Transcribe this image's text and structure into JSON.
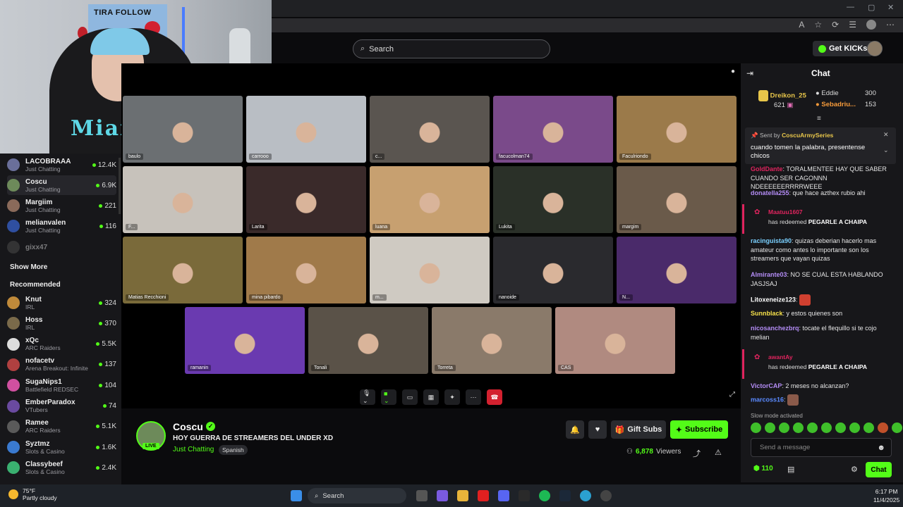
{
  "browser": {
    "window_controls": [
      "—",
      "▢",
      "✕"
    ]
  },
  "header": {
    "search_placeholder": "Search",
    "get_kicks_label": "Get KICKs"
  },
  "webcam": {
    "poster_text": "TIRA FOLLOW",
    "shirt_text": "Miami"
  },
  "sidebar": {
    "following": [
      {
        "name": "LACOBRAAA",
        "category": "Just Chatting",
        "viewers": "12.4K",
        "color": "#6a6f9a"
      },
      {
        "name": "Coscu",
        "category": "Just Chatting",
        "viewers": "6.9K",
        "color": "#6d8a5a",
        "active": true
      },
      {
        "name": "Margiim",
        "category": "Just Chatting",
        "viewers": "221",
        "color": "#8a6a5a"
      },
      {
        "name": "melianvalen",
        "category": "Just Chatting",
        "viewers": "116",
        "color": "#2f4fa0"
      }
    ],
    "offline": {
      "name": "gixx47"
    },
    "show_more_label": "Show More",
    "recommended_label": "Recommended",
    "recommended": [
      {
        "name": "Knut",
        "category": "IRL",
        "viewers": "324",
        "color": "#c08a3a"
      },
      {
        "name": "Hoss",
        "category": "IRL",
        "viewers": "370",
        "color": "#7a6a4a"
      },
      {
        "name": "xQc",
        "category": "ARC Raiders",
        "viewers": "5.5K",
        "color": "#ddd"
      },
      {
        "name": "nofacetv",
        "category": "Arena Breakout: Infinite",
        "viewers": "137",
        "color": "#b04040"
      },
      {
        "name": "SugaNips1",
        "category": "Battlefield REDSEC",
        "viewers": "104",
        "color": "#d050a0"
      },
      {
        "name": "EmberParadox",
        "category": "VTubers",
        "viewers": "74",
        "color": "#6a4aa0"
      },
      {
        "name": "Ramee",
        "category": "ARC Raiders",
        "viewers": "5.1K",
        "color": "#5a5a5a"
      },
      {
        "name": "Syztmz",
        "category": "Slots & Casino",
        "viewers": "1.6K",
        "color": "#3a7ad0"
      },
      {
        "name": "Classybeef",
        "category": "Slots & Casino",
        "viewers": "2.4K",
        "color": "#3ab070"
      }
    ]
  },
  "video": {
    "tiles": [
      {
        "label": "baulo",
        "bg": "#6b6f72"
      },
      {
        "label": "carrooo",
        "bg": "#b9bec4"
      },
      {
        "label": "c...",
        "bg": "#5a5550"
      },
      {
        "label": "facucolman74",
        "bg": "#7a4a8a"
      },
      {
        "label": "Faculriondo",
        "bg": "#9b7a4a"
      },
      {
        "label": "F...",
        "bg": "#c7c2bb"
      },
      {
        "label": "Larita",
        "bg": "#3a2a2a"
      },
      {
        "label": "luana",
        "bg": "#c7a070"
      },
      {
        "label": "Lukita",
        "bg": "#2a3028"
      },
      {
        "label": "margim",
        "bg": "#6a5a4a"
      },
      {
        "label": "Matias Recchioni",
        "bg": "#7a6a3a"
      },
      {
        "label": "mina pibardo",
        "bg": "#a07a4a"
      },
      {
        "label": "m...",
        "bg": "#cfcac2"
      },
      {
        "label": "nanoide",
        "bg": "#2a2a2e"
      },
      {
        "label": "N...",
        "bg": "#4a2a6a"
      },
      {
        "label": "ramanin",
        "bg": "#6a3ab0"
      },
      {
        "label": "Tonali",
        "bg": "#5a5248"
      },
      {
        "label": "Torreta",
        "bg": "#8a7a6a"
      },
      {
        "label": "CAS",
        "bg": "#b08a80"
      }
    ]
  },
  "stream": {
    "live_badge": "LIVE",
    "name": "Coscu",
    "title": "HOY GUERRA DE STREAMERS DEL UNDER XD",
    "category": "Just Chatting",
    "tag": "Spanish",
    "gift_subs_label": "Gift Subs",
    "subscribe_label": "Subscribe",
    "viewers_count": "6,878",
    "viewers_label": "Viewers"
  },
  "chat": {
    "title": "Chat",
    "leaderboard": [
      {
        "name": "Dreikon_25",
        "count": "621"
      },
      {
        "name": "Eddie",
        "count": "300"
      },
      {
        "name": "Sebadriu...",
        "count": "153"
      }
    ],
    "pinned_sent_by": "Sent by",
    "pinned_user": "CoscuArmySeries",
    "pinned_text": "cuando tomen la palabra, presentense chicos",
    "messages": [
      {
        "user": "GoldDante",
        "text": "TORALMENTEE HAY QUE SABER CUANDO SER CAGONNN NDEEEEEERRRRWEEE",
        "color": "#e0245e"
      },
      {
        "user": "donatella255",
        "text": "que hace azthex rubio ahi",
        "color": "#b38cf5"
      },
      {
        "user": "racinguista90",
        "text": "quizas deberian hacerlo mas amateur como antes lo importante son los streamers que vayan quizas",
        "color": "#7ad0ff"
      },
      {
        "user": "Almirante03",
        "text": "NO SE CUAL ESTA HABLANDO JASJSAJ",
        "color": "#b38cf5"
      },
      {
        "user": "Litoxeneize123",
        "text": "",
        "color": "#ffffff"
      },
      {
        "user": "Sunnblack",
        "text": "y estos quienes son",
        "color": "#f5e04a"
      },
      {
        "user": "nicosanchezbrq",
        "text": "tocate el flequillo si te cojo melian",
        "color": "#b38cf5"
      },
      {
        "user": "VictorCAP",
        "text": "2 meses no alcanzan?",
        "color": "#b38cf5"
      },
      {
        "user": "marcoss16",
        "text": "",
        "color": "#5a8aff"
      }
    ],
    "redeems": [
      {
        "user": "Maatuu1607",
        "action": "has redeemed",
        "reward": "PEGARLE A CHAIPA"
      },
      {
        "user": "awantAy",
        "action": "has redeemed",
        "reward": "PEGARLE A CHAIPA"
      }
    ],
    "slow_mode": "Slow mode activated",
    "send_placeholder": "Send a message",
    "kicks_count": "110",
    "chat_button": "Chat"
  },
  "taskbar": {
    "temp": "75°F",
    "weather": "Partly cloudy",
    "search": "Search",
    "time": "6:17 PM",
    "date": "11/4/2025"
  }
}
